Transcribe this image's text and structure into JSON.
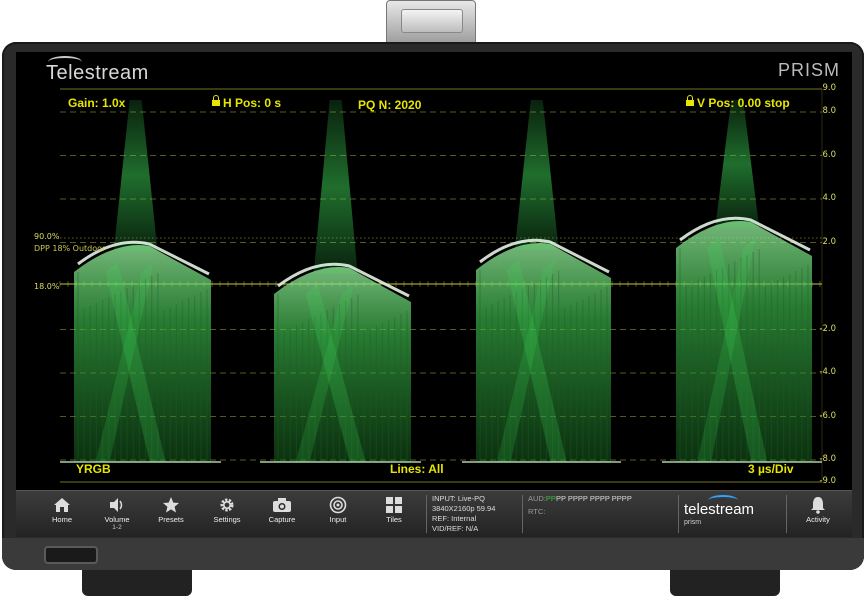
{
  "device": {
    "brand": "Telestream",
    "model": "PRISM"
  },
  "hud": {
    "gain": "Gain: 1.0x",
    "hpos": "H Pos: 0 s",
    "pq": "PQ N: 2020",
    "vpos": "V Pos: 0.00 stop",
    "mode": "YRGB",
    "lines": "Lines: All",
    "timebase": "3 µs/Div",
    "marker_90": "90.0%",
    "marker_18": "18.0%",
    "dpp_label": "DPP 18% Outdoor"
  },
  "scale_labels": [
    "9.0",
    "8.0",
    "6.0",
    "4.0",
    "2.0",
    "-2.0",
    "-4.0",
    "-6.0",
    "-8.0",
    "-9.0"
  ],
  "scale_values": [
    9.0,
    8.0,
    6.0,
    4.0,
    2.0,
    -2.0,
    -4.0,
    -6.0,
    -8.0,
    -9.0
  ],
  "colors": {
    "trace": "#3fdc5a",
    "graticule": "#d8d84a",
    "hud_text": "#e6e600",
    "accent": "#2fa3ff"
  },
  "toolbar": {
    "buttons": [
      {
        "label": "Home",
        "icon": "home-icon"
      },
      {
        "label": "Volume",
        "sub": "1-2",
        "icon": "speaker-icon"
      },
      {
        "label": "Presets",
        "icon": "star-icon"
      },
      {
        "label": "Settings",
        "icon": "gear-icon"
      },
      {
        "label": "Capture",
        "icon": "camera-icon"
      },
      {
        "label": "Input",
        "icon": "target-icon"
      },
      {
        "label": "Tiles",
        "icon": "tiles-icon"
      }
    ],
    "input_info": {
      "input": "INPUT: Live-PQ",
      "format": "3840X2160p 59.94",
      "ref": "REF: Internal",
      "vidref": "VID/REF: N/A"
    },
    "aud_label": "AUD:",
    "aud_green": "PP",
    "aud_rest": "PP PPPP PPPP PPPP",
    "rtc": "RTC:",
    "logo": "telestream",
    "logo_sub": "prism",
    "activity": {
      "label": "Activity",
      "icon": "bell-icon"
    }
  }
}
